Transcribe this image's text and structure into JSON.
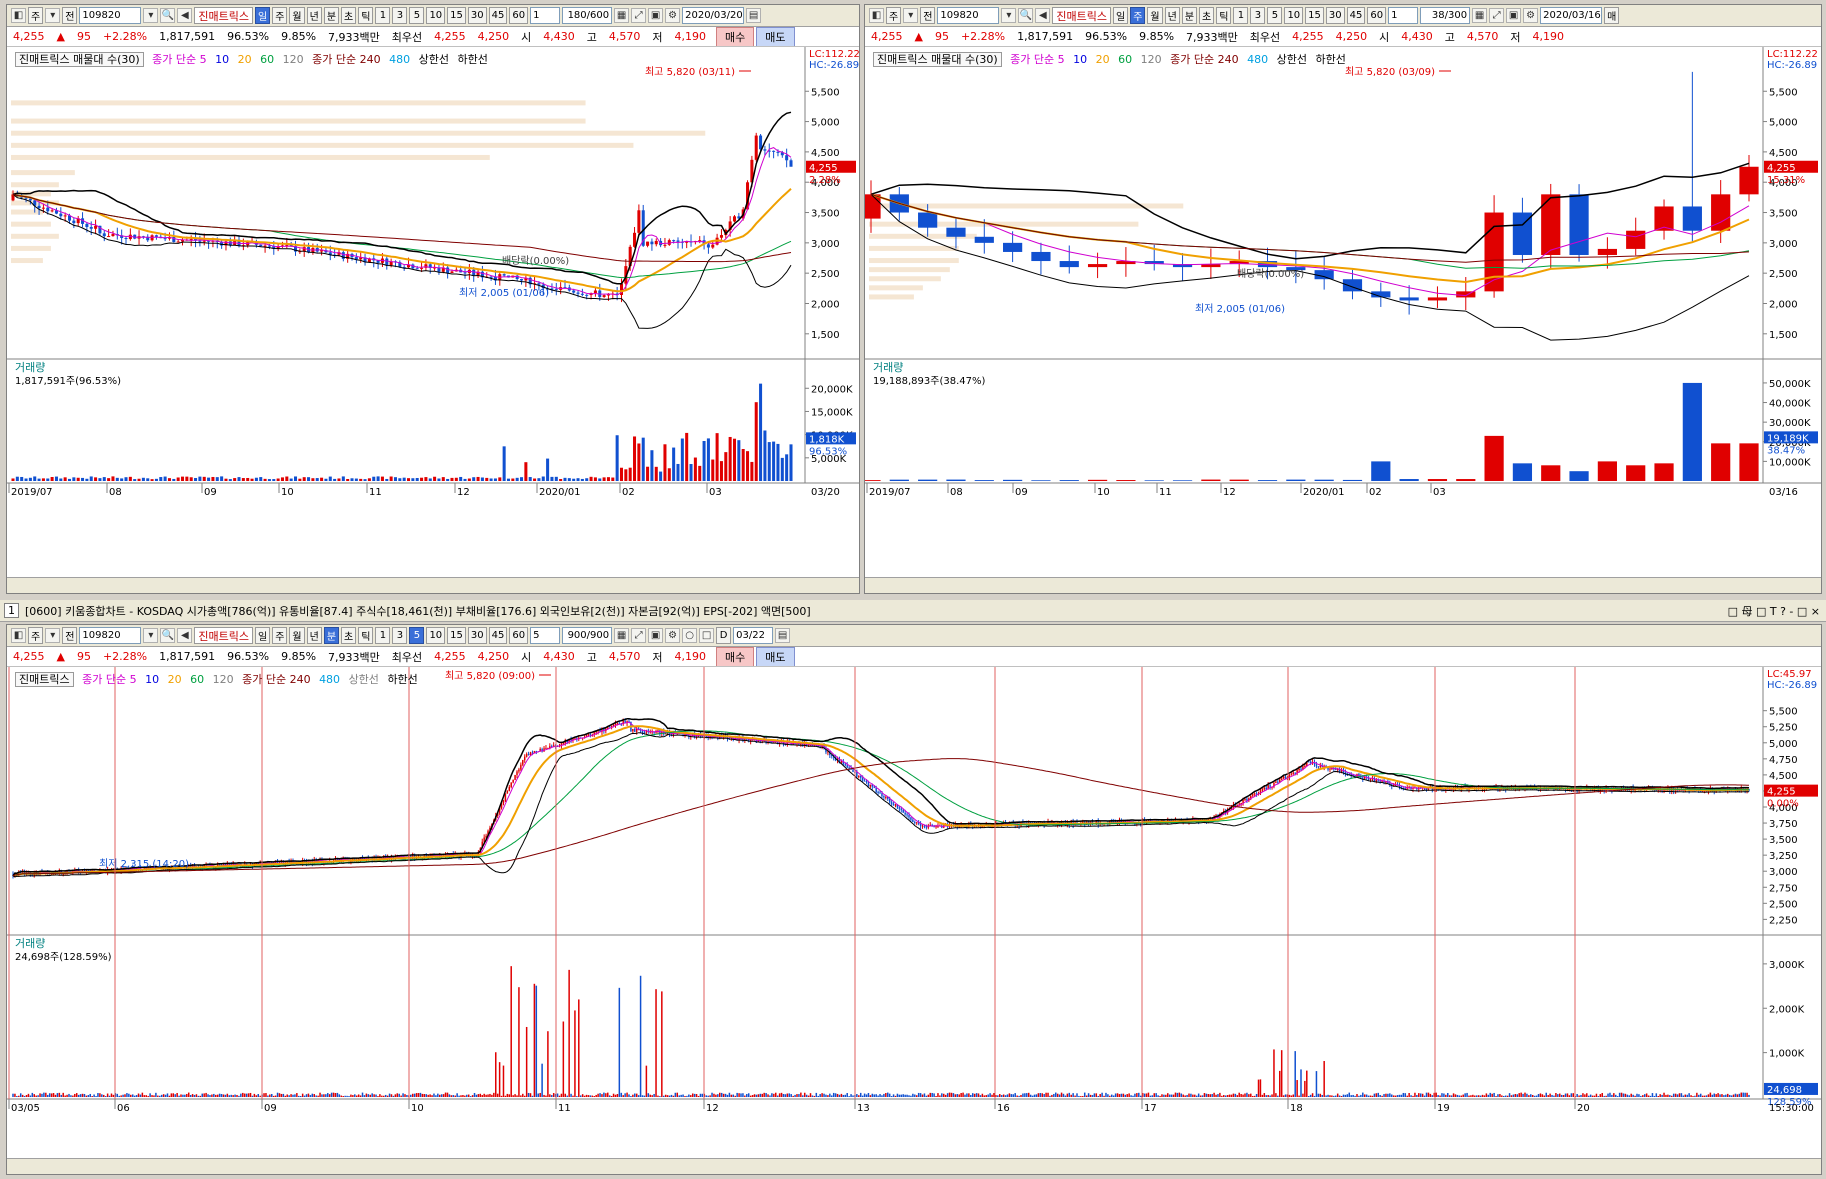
{
  "common": {
    "stock_code": "109820",
    "stock_name": "진매트릭스",
    "market_prefix": "주",
    "jeon": "전",
    "price": "4,255",
    "change": "95",
    "change_pct": "+2.28%",
    "volume": "1,817,591",
    "vol_ratio": "96.53%",
    "turnover": "9.85%",
    "amount": "7,933백만",
    "best_label": "최우선",
    "ask": "4,255",
    "bid": "4,250",
    "open_label": "시",
    "open": "4,430",
    "high_label": "고",
    "high": "4,570",
    "low_label": "저",
    "low": "4,190",
    "buy_label": "매수",
    "sell_label": "매도",
    "period_tabs": [
      "일",
      "주",
      "월",
      "년",
      "분",
      "초",
      "틱"
    ],
    "interval_tabs": [
      "1",
      "3",
      "5",
      "10",
      "15",
      "30",
      "45",
      "60"
    ],
    "legend_indicator": "진매트릭스 매물대 수(30)",
    "legend_ma1": "종가 단순 5",
    "legend_ma1_vals": [
      "10",
      "20",
      "60",
      "120"
    ],
    "legend_ma2": "종가 단순 240",
    "legend_ma2_val": "480",
    "legend_band": "상한선",
    "legend_band2": "하한선",
    "volume_label": "거래량"
  },
  "daily": {
    "count_display": "180/600",
    "date": "2020/03/20",
    "interval_sel": "1",
    "lc": "LC:112.22",
    "hc": "HC:-26.89",
    "last_price_tag": "4,255",
    "last_pct_tag": "2.28%",
    "high_annot": "최고 5,820 (03/11)",
    "low_annot": "최저 2,005 (01/06)",
    "div_annot": "배당락(0.00%)",
    "vol_text": "1,817,591주(96.53%)",
    "vol_tag": "1,818K",
    "vol_pct_tag": "96.53%",
    "y_ticks": [
      "5,500",
      "5,000",
      "4,500",
      "4,000",
      "3,500",
      "3,000",
      "2,500",
      "2,000",
      "1,500"
    ],
    "vol_ticks": [
      "20,000K",
      "15,000K",
      "10,000K",
      "5,000K"
    ],
    "x_labels": [
      "2019/07",
      "08",
      "09",
      "10",
      "11",
      "12",
      "2020/01",
      "02",
      "03"
    ],
    "end_label": "03/20"
  },
  "weekly": {
    "count_display": "38/300",
    "date": "2020/03/16",
    "interval_sel": "1",
    "lc": "LC:112.22",
    "hc": "HC:-26.89",
    "last_price_tag": "4,255",
    "last_pct_tag": "15.31%",
    "high_annot": "최고 5,820 (03/09)",
    "low_annot": "최저 2,005 (01/06)",
    "div_annot": "배당락(0.00%)",
    "vol_text": "19,188,893주(38.47%)",
    "vol_tag": "19,189K",
    "vol_pct_tag": "38.47%",
    "y_ticks": [
      "5,500",
      "5,000",
      "4,500",
      "4,000",
      "3,500",
      "3,000",
      "2,500",
      "2,000",
      "1,500"
    ],
    "vol_ticks": [
      "50,000K",
      "40,000K",
      "30,000K",
      "20,000K",
      "10,000K"
    ],
    "x_labels": [
      "2019/07",
      "08",
      "09",
      "10",
      "11",
      "12",
      "2020/01",
      "02",
      "03"
    ],
    "end_label": "03/16",
    "trailing": "매"
  },
  "minute": {
    "info_bar": "[0600] 키움종합차트 - KOSDAQ 시가총액[786(억)] 유통비율[87.4] 주식수[18,461(천)] 부채비율[176.6] 외국인보유[2(천)] 자본금[92(억)] EPS[-202] 액면[500]",
    "panel_num": "1",
    "count_display": "900/900",
    "date": "03/22",
    "interval_sel": "5",
    "d_label": "D",
    "lc": "LC:45.97",
    "hc": "HC:-26.89",
    "last_price_tag": "4,255",
    "last_pct_tag": "0.00%",
    "high_annot": "최고 5,820 (09:00)",
    "low_annot": "최저 2,315 (14:20)",
    "vol_text": "24,698주(128.59%)",
    "vol_tag": "24,698",
    "vol_pct_tag": "128.59%",
    "y_ticks": [
      "5,500",
      "5,250",
      "5,000",
      "4,750",
      "4,500",
      "4,250",
      "4,000",
      "3,750",
      "3,500",
      "3,250",
      "3,000",
      "2,750",
      "2,500",
      "2,250"
    ],
    "vol_ticks": [
      "3,000K",
      "2,000K",
      "1,000K"
    ],
    "x_labels": [
      "03/05",
      "06",
      "09",
      "10",
      "11",
      "12",
      "13",
      "16",
      "17",
      "18",
      "19",
      "20"
    ],
    "end_label": "15:30:00",
    "window_controls": "□ 母 □ T ? -  □ ×"
  },
  "colors": {
    "up": "#e00000",
    "down": "#1050d0",
    "ma5": "#d000d0",
    "ma20": "#f0a000",
    "ma60": "#00a040",
    "ma120": "#808080",
    "ma240": "#800000",
    "bollinger": "#000000",
    "volume_profile": "#f5e6d3",
    "price_tag": "#e00000",
    "vol_tag": "#1050d0"
  }
}
